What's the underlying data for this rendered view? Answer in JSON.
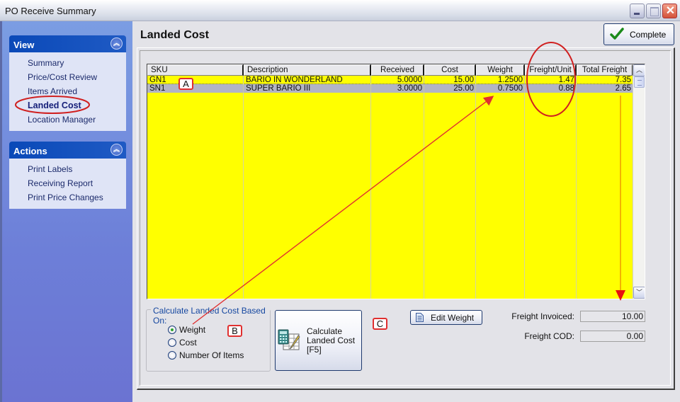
{
  "window": {
    "title": "PO Receive Summary",
    "controls": {
      "minimize": "minimize",
      "maximize": "maximize",
      "close": "close"
    }
  },
  "sidebar": {
    "view": {
      "title": "View",
      "items": [
        {
          "label": "Summary"
        },
        {
          "label": "Price/Cost Review"
        },
        {
          "label": "Items Arrived"
        },
        {
          "label": "Landed Cost",
          "active": true
        },
        {
          "label": "Location Manager"
        }
      ]
    },
    "actions": {
      "title": "Actions",
      "items": [
        {
          "label": "Print Labels"
        },
        {
          "label": "Receiving Report"
        },
        {
          "label": "Print Price Changes"
        }
      ]
    }
  },
  "main": {
    "page_title": "Landed Cost",
    "complete_label": "Complete",
    "grid": {
      "columns": [
        "SKU",
        "Description",
        "Received",
        "Cost",
        "Weight",
        "Freight/Unit",
        "Total Freight"
      ],
      "rows": [
        {
          "sku": "GN1",
          "description": "BARIO IN WONDERLAND",
          "received": "5.0000",
          "cost": "15.00",
          "weight": "1.2500",
          "freight_unit": "1.47",
          "total_freight": "7.35"
        },
        {
          "sku": "SN1",
          "description": "SUPER BARIO III",
          "received": "3.0000",
          "cost": "25.00",
          "weight": "0.7500",
          "freight_unit": "0.88",
          "total_freight": "2.65"
        }
      ],
      "row_background": "#ffff00",
      "selected_row_background": "#b2b4c6"
    },
    "calc_group": {
      "legend": "Calculate Landed Cost Based On:",
      "options": [
        {
          "label": "Weight",
          "selected": true
        },
        {
          "label": "Cost",
          "selected": false
        },
        {
          "label": "Number Of Items",
          "selected": false
        }
      ]
    },
    "calc_button": {
      "line1": "Calculate",
      "line2": "Landed Cost",
      "line3": "[F5]"
    },
    "edit_weight_label": "Edit Weight",
    "freight_invoiced": {
      "label": "Freight Invoiced:",
      "value": "10.00"
    },
    "freight_cod": {
      "label": "Freight COD:",
      "value": "0.00"
    }
  },
  "annotations": {
    "tags": [
      "A",
      "B",
      "C"
    ],
    "color": "#e03030",
    "arrow_color": "#e03030",
    "orange_arrow_color": "#f0a000"
  }
}
